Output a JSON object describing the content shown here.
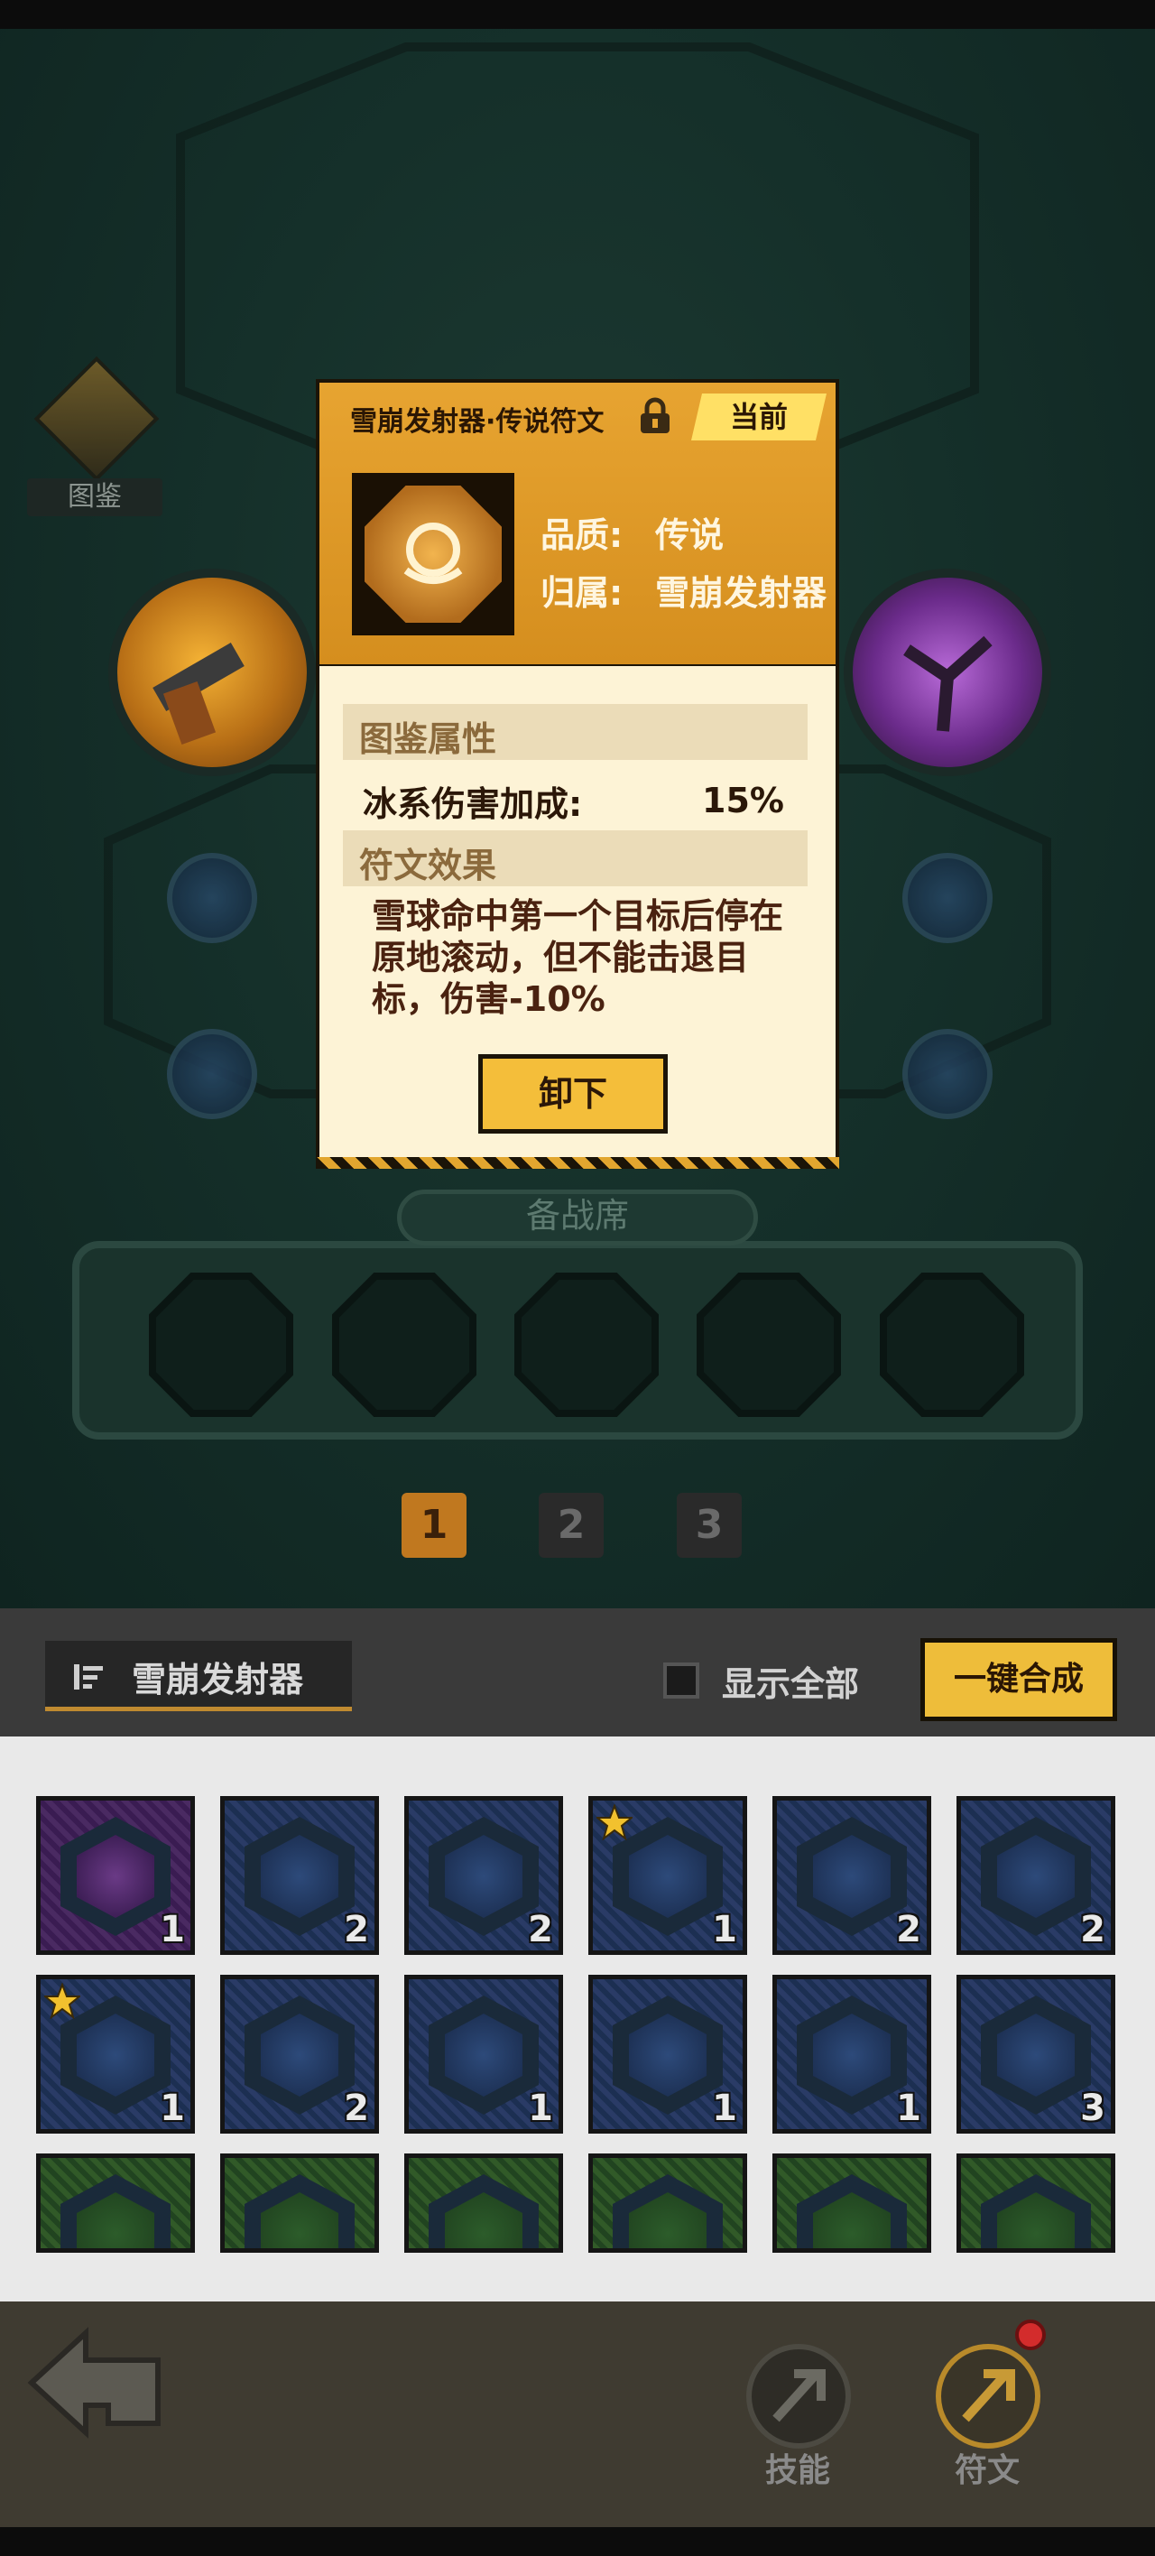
{
  "catalog": {
    "label": "图鉴"
  },
  "popup": {
    "title": "雪崩发射器·传说符文",
    "current_badge": "当前",
    "quality_label": "品质:",
    "quality_value": "传说",
    "owner_label": "归属:",
    "owner_value": "雪崩发射器",
    "section_attr": "图鉴属性",
    "stat_name": "冰系伤害加成:",
    "stat_value": "15%",
    "section_effect": "符文效果",
    "effect_text": "雪球命中第一个目标后停在原地滚动，但不能击退目标，伤害-10%",
    "unequip_label": "卸下"
  },
  "bench": {
    "title": "备战席"
  },
  "pages": [
    "1",
    "2",
    "3"
  ],
  "toolbar": {
    "filter_label": "雪崩发射器",
    "show_all_label": "显示全部",
    "merge_label": "一键合成"
  },
  "inventory": {
    "row1": [
      {
        "count": "1",
        "color": "purple",
        "star": false
      },
      {
        "count": "2",
        "color": "blue",
        "star": false
      },
      {
        "count": "2",
        "color": "blue",
        "star": false
      },
      {
        "count": "1",
        "color": "blue",
        "star": true
      },
      {
        "count": "2",
        "color": "blue",
        "star": false
      },
      {
        "count": "2",
        "color": "blue",
        "star": false
      }
    ],
    "row2": [
      {
        "count": "1",
        "color": "blue",
        "star": true
      },
      {
        "count": "2",
        "color": "blue",
        "star": false
      },
      {
        "count": "1",
        "color": "blue",
        "star": false
      },
      {
        "count": "1",
        "color": "blue",
        "star": false
      },
      {
        "count": "1",
        "color": "blue",
        "star": false
      },
      {
        "count": "3",
        "color": "blue",
        "star": false
      }
    ],
    "row3": [
      {
        "color": "green"
      },
      {
        "color": "green"
      },
      {
        "color": "green"
      },
      {
        "color": "green"
      },
      {
        "color": "green"
      },
      {
        "color": "green"
      }
    ]
  },
  "nav": {
    "skill_label": "技能",
    "rune_label": "符文"
  },
  "colors": {
    "accent": "#e7a431",
    "purple": "#6a3a86",
    "blue": "#2d4a7a",
    "green": "#2c5c2a"
  }
}
